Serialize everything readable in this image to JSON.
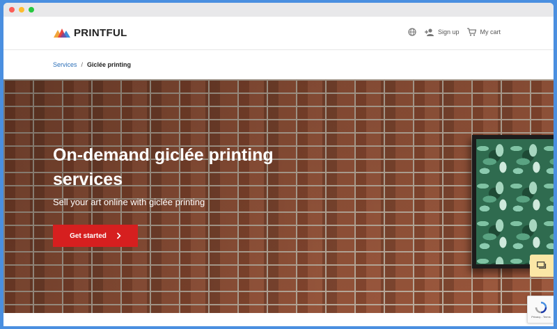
{
  "browser": {
    "controls": [
      "close",
      "minimize",
      "maximize"
    ]
  },
  "header": {
    "logo_text": "PRINTFUL",
    "nav": [
      {
        "icon": "globe-icon",
        "label": ""
      },
      {
        "icon": "add-user-icon",
        "label": "Sign up"
      },
      {
        "icon": "cart-icon",
        "label": "My cart"
      }
    ]
  },
  "breadcrumb": {
    "link": "Services",
    "separator": "/",
    "current": "Giclée printing"
  },
  "hero": {
    "title": "On-demand giclée printing services",
    "subtitle": "Sell your art online with giclée printing",
    "cta_label": "Get started"
  },
  "widgets": {
    "chat_icon": "chat-icon",
    "recaptcha_text": "Privacy - Terms"
  },
  "colors": {
    "accent_red": "#d61f1f",
    "link_blue": "#2b6fb8",
    "chat_bg": "#fbe7a6",
    "border_blue": "#4a8fe0"
  }
}
